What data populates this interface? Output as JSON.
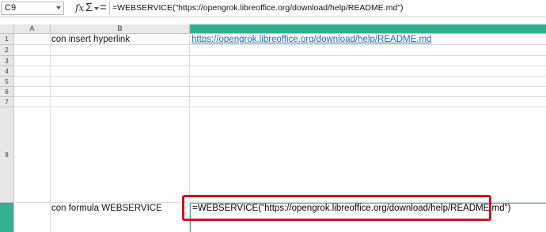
{
  "formula_bar": {
    "name_box": "C9",
    "fx_icon": "fx",
    "sum_icon": "Σ",
    "equals_icon": "=",
    "formula": "=WEBSERVICE(\"https://opengrok.libreoffice.org/download/help/README.md\")"
  },
  "columns": [
    "A",
    "B"
  ],
  "rows": [
    "1",
    "2",
    "3",
    "4",
    "5",
    "6",
    "7",
    "8",
    ""
  ],
  "cells": {
    "b2": "con insert hyperlink",
    "c2": "https://opengrok.libreoffice.org/download/help/README.md",
    "b9": "con formula WEBSERVICE",
    "c9": "=WEBSERVICE(\"https://opengrok.libreoffice.org/download/help/README.md\")"
  },
  "colors": {
    "selection": "#33b08f",
    "highlight_box": "#c8161d",
    "link": "#1c68a8"
  }
}
